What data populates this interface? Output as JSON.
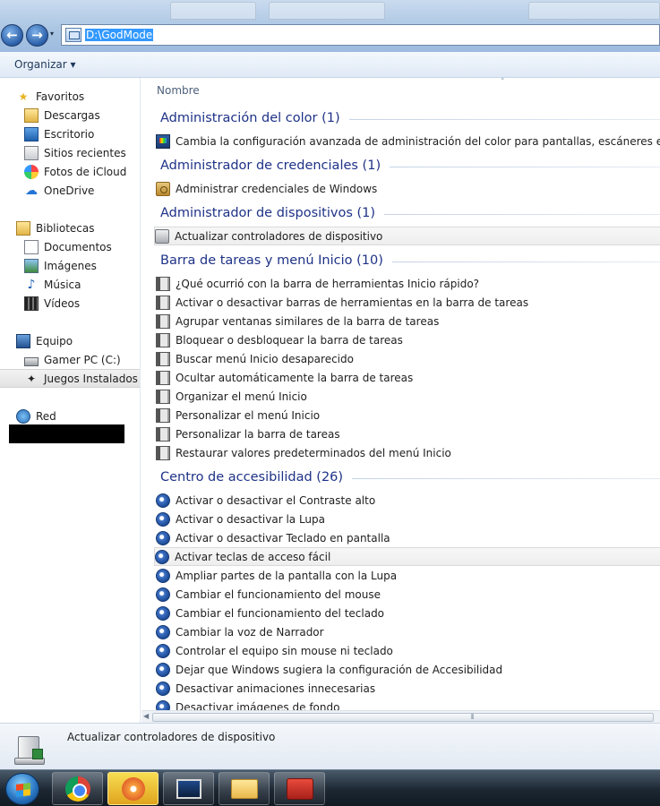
{
  "address": {
    "path": "D:\\GodMode"
  },
  "toolbar": {
    "organize_label": "Organizar",
    "organize_arrow": "▾"
  },
  "nav": {
    "back_glyph": "←",
    "forward_glyph": "→",
    "history_glyph": "▾"
  },
  "sidebar": {
    "favorites": {
      "label": "Favoritos",
      "icon": "star-icon"
    },
    "favorites_items": [
      {
        "label": "Descargas",
        "icon": "downloads-folder-icon"
      },
      {
        "label": "Escritorio",
        "icon": "desktop-icon"
      },
      {
        "label": "Sitios recientes",
        "icon": "recent-places-icon"
      },
      {
        "label": "Fotos de iCloud",
        "icon": "icloud-photos-icon"
      },
      {
        "label": "OneDrive",
        "icon": "cloud-icon"
      }
    ],
    "libraries": {
      "label": "Bibliotecas",
      "icon": "libraries-icon"
    },
    "libraries_items": [
      {
        "label": "Documentos",
        "icon": "documents-icon"
      },
      {
        "label": "Imágenes",
        "icon": "pictures-icon"
      },
      {
        "label": "Música",
        "icon": "music-icon"
      },
      {
        "label": "Vídeos",
        "icon": "videos-icon"
      }
    ],
    "computer": {
      "label": "Equipo",
      "icon": "computer-icon"
    },
    "computer_items": [
      {
        "label": "Gamer PC (C:)",
        "icon": "drive-icon"
      },
      {
        "label": "Juegos Instalados (D",
        "icon": "playstation-drive-icon",
        "selected": true
      }
    ],
    "network": {
      "label": "Red",
      "icon": "network-icon"
    }
  },
  "content": {
    "column_header": "Nombre",
    "groups": [
      {
        "title": "Administración del color (1)",
        "icon": "color-management-icon",
        "items": [
          "Cambia la configuración avanzada de administración del color para pantallas, escáneres e impresoras"
        ]
      },
      {
        "title": "Administrador de credenciales (1)",
        "icon": "credential-vault-icon",
        "items": [
          "Administrar credenciales de Windows"
        ]
      },
      {
        "title": "Administrador de dispositivos (1)",
        "icon": "device-manager-icon",
        "items": [
          "Actualizar controladores de dispositivo"
        ]
      },
      {
        "title": "Barra de tareas y menú Inicio (10)",
        "icon": "taskbar-icon",
        "items": [
          "¿Qué ocurrió con la barra de herramientas Inicio rápido?",
          "Activar o desactivar barras de herramientas en la barra de tareas",
          "Agrupar ventanas similares de la barra de tareas",
          "Bloquear o desbloquear la barra de tareas",
          "Buscar menú Inicio desaparecido",
          "Ocultar automáticamente la barra de tareas",
          "Organizar el menú Inicio",
          "Personalizar el menú Inicio",
          "Personalizar la barra de tareas",
          "Restaurar valores predeterminados del menú Inicio"
        ]
      },
      {
        "title": "Centro de accesibilidad (26)",
        "icon": "ease-of-access-icon",
        "items": [
          "Activar o desactivar el Contraste alto",
          "Activar o desactivar la Lupa",
          "Activar o desactivar Teclado en pantalla",
          "Activar teclas de acceso fácil",
          "Ampliar partes de la pantalla con la Lupa",
          "Cambiar el funcionamiento del mouse",
          "Cambiar el funcionamiento del teclado",
          "Cambiar la voz de Narrador",
          "Controlar el equipo sin mouse ni teclado",
          "Dejar que Windows sugiera la configuración de Accesibilidad",
          "Desactivar animaciones innecesarias",
          "Desactivar imágenes de fondo"
        ]
      }
    ],
    "highlighted": [
      "Actualizar controladores de dispositivo",
      "Activar teclas de acceso fácil"
    ]
  },
  "details": {
    "text": "Actualizar controladores de dispositivo",
    "icon": "device-manager-large-icon"
  },
  "taskbar": {
    "start": "windows-start-icon",
    "apps": [
      "chrome-icon",
      "orange-app-icon",
      "display-app-icon",
      "folder-icon",
      "toolbox-icon"
    ]
  },
  "colors": {
    "group_title": "#1e3287",
    "address_selection": "#3399ff",
    "taskbar_active": "#f7dd52"
  }
}
